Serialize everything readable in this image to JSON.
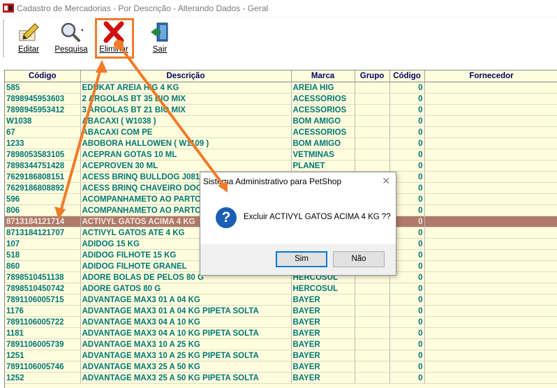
{
  "window": {
    "title": "Cadastro de Mercadorias - Por Descrição - Alterando Dados - Geral"
  },
  "toolbar": {
    "editar": "Editar",
    "pesquisa": "Pesquisa",
    "eliminar": "Eliminar",
    "sair": "Sair"
  },
  "grid": {
    "columns": [
      "Código",
      "Descrição",
      "Marca",
      "Grupo",
      "Código",
      "Fornecedor"
    ],
    "rows": [
      {
        "codigo": "585",
        "descricao": " EDUKAT AREIA HIG 4 KG",
        "marca": "AREIA HIG",
        "grupo": "",
        "cod2": "0",
        "fornecedor": ""
      },
      {
        "codigo": "7898945953603",
        "descricao": "2 ARGOLAS BT 35  BIO MIX",
        "marca": "ACESSORIOS",
        "grupo": "",
        "cod2": "0",
        "fornecedor": ""
      },
      {
        "codigo": "7898945953412",
        "descricao": "3 ARGOLAS BT 21 BIO MIX",
        "marca": "ACESSORIOS",
        "grupo": "",
        "cod2": "0",
        "fornecedor": ""
      },
      {
        "codigo": "W1038",
        "descricao": "ABACAXI ( W1038 )",
        "marca": "BOM AMIGO",
        "grupo": "",
        "cod2": "0",
        "fornecedor": ""
      },
      {
        "codigo": "67",
        "descricao": "ABACAXI COM PE",
        "marca": "ACESSORIOS",
        "grupo": "",
        "cod2": "0",
        "fornecedor": ""
      },
      {
        "codigo": "1233",
        "descricao": "ABOBORA HALLOWEN ( W1109 )",
        "marca": "BOM AMIGO",
        "grupo": "",
        "cod2": "0",
        "fornecedor": ""
      },
      {
        "codigo": "7898053583105",
        "descricao": "ACEPRAN GOTAS 10 ML",
        "marca": "VETMINAS",
        "grupo": "",
        "cod2": "0",
        "fornecedor": ""
      },
      {
        "codigo": "7898344751428",
        "descricao": "ACEPROVEN 30 ML",
        "marca": "PLANET",
        "grupo": "",
        "cod2": "0",
        "fornecedor": ""
      },
      {
        "codigo": "7629186808151",
        "descricao": "ACESS BRINQ BULLDOG J081",
        "marca": "",
        "grupo": "",
        "cod2": "0",
        "fornecedor": ""
      },
      {
        "codigo": "7629186808892",
        "descricao": "ACESS BRINQ CHAVEIRO DOG",
        "marca": "",
        "grupo": "",
        "cod2": "0",
        "fornecedor": ""
      },
      {
        "codigo": "596",
        "descricao": "ACOMPANHAMETO AO PARTO",
        "marca": "",
        "grupo": "",
        "cod2": "0",
        "fornecedor": ""
      },
      {
        "codigo": "806",
        "descricao": "ACOMPANHAMETO AO PARTO",
        "marca": "",
        "grupo": "",
        "cod2": "0",
        "fornecedor": ""
      },
      {
        "codigo": "8713184121714",
        "descricao": "ACTIVYL GATOS ACIMA 4 KG",
        "marca": "",
        "grupo": "",
        "cod2": "0",
        "fornecedor": "",
        "selected": true
      },
      {
        "codigo": "8713184121707",
        "descricao": "ACTIVYL GATOS ATE 4 KG",
        "marca": "",
        "grupo": "",
        "cod2": "0",
        "fornecedor": ""
      },
      {
        "codigo": "107",
        "descricao": "ADIDOG 15 KG",
        "marca": "",
        "grupo": "",
        "cod2": "0",
        "fornecedor": ""
      },
      {
        "codigo": "518",
        "descricao": "ADIDOG FILHOTE 15 KG",
        "marca": "",
        "grupo": "",
        "cod2": "0",
        "fornecedor": ""
      },
      {
        "codigo": "860",
        "descricao": "ADIDOG FILHOTE GRANEL",
        "marca": "",
        "grupo": "",
        "cod2": "0",
        "fornecedor": ""
      },
      {
        "codigo": "7898510451138",
        "descricao": "ADORE BOLAS DE PELOS 80 G",
        "marca": "HERCOSUL",
        "grupo": "",
        "cod2": "0",
        "fornecedor": ""
      },
      {
        "codigo": "7898510450742",
        "descricao": "ADORE GATOS 80 G",
        "marca": "HERCOSUL",
        "grupo": "",
        "cod2": "0",
        "fornecedor": ""
      },
      {
        "codigo": "7891106005715",
        "descricao": "ADVANTAGE MAX3 01 A 04 KG",
        "marca": "BAYER",
        "grupo": "",
        "cod2": "0",
        "fornecedor": ""
      },
      {
        "codigo": "1176",
        "descricao": "ADVANTAGE MAX3 01 A 04 KG PIPETA SOLTA",
        "marca": "BAYER",
        "grupo": "",
        "cod2": "0",
        "fornecedor": ""
      },
      {
        "codigo": "7891106005722",
        "descricao": "ADVANTAGE MAX3 04 A 10 KG",
        "marca": "BAYER",
        "grupo": "",
        "cod2": "0",
        "fornecedor": ""
      },
      {
        "codigo": "1181",
        "descricao": "ADVANTAGE MAX3 04 A 10 KG PIPETA SOLTA",
        "marca": "BAYER",
        "grupo": "",
        "cod2": "0",
        "fornecedor": ""
      },
      {
        "codigo": "7891106005739",
        "descricao": "ADVANTAGE MAX3 10 A 25 KG",
        "marca": "BAYER",
        "grupo": "",
        "cod2": "0",
        "fornecedor": ""
      },
      {
        "codigo": "1251",
        "descricao": "ADVANTAGE MAX3 10 A 25 KG PIPETA SOLTA",
        "marca": "BAYER",
        "grupo": "",
        "cod2": "0",
        "fornecedor": ""
      },
      {
        "codigo": "7891106005746",
        "descricao": "ADVANTAGE MAX3 25 A 50 KG",
        "marca": "BAYER",
        "grupo": "",
        "cod2": "0",
        "fornecedor": ""
      },
      {
        "codigo": "1252",
        "descricao": "ADVANTAGE MAX3 25 A 50 KG PIPETA SOLTA",
        "marca": "BAYER",
        "grupo": "",
        "cod2": "0",
        "fornecedor": ""
      }
    ]
  },
  "dialog": {
    "title": "Sistema Administrativo para PetShop",
    "message": "Excluir ACTIVYL GATOS ACIMA 4 KG ??",
    "yes": "Sim",
    "no": "Não",
    "close": "✕"
  },
  "colors": {
    "accent": "#f07b28",
    "row_text": "#007878",
    "header_text": "#000066",
    "grid_bg": "#fffddd",
    "selected_row": "#b07a6a"
  }
}
